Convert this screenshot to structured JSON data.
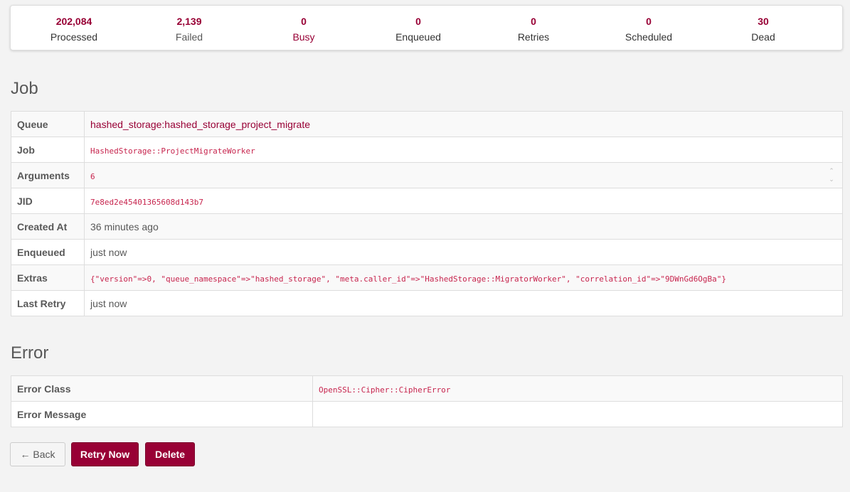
{
  "summary": [
    {
      "value": "202,084",
      "label": "Processed"
    },
    {
      "value": "2,139",
      "label": "Failed"
    },
    {
      "value": "0",
      "label": "Busy"
    },
    {
      "value": "0",
      "label": "Enqueued"
    },
    {
      "value": "0",
      "label": "Retries"
    },
    {
      "value": "0",
      "label": "Scheduled"
    },
    {
      "value": "30",
      "label": "Dead"
    }
  ],
  "job": {
    "heading": "Job",
    "rows": {
      "queue": {
        "label": "Queue",
        "value": "hashed_storage:hashed_storage_project_migrate"
      },
      "job": {
        "label": "Job",
        "value": "HashedStorage::ProjectMigrateWorker"
      },
      "arguments": {
        "label": "Arguments",
        "value": "6"
      },
      "jid": {
        "label": "JID",
        "value": "7e8ed2e45401365608d143b7"
      },
      "created_at": {
        "label": "Created At",
        "value": "36 minutes ago"
      },
      "enqueued": {
        "label": "Enqueued",
        "value": "just now"
      },
      "extras": {
        "label": "Extras",
        "value": "{\"version\"=>0, \"queue_namespace\"=>\"hashed_storage\", \"meta.caller_id\"=>\"HashedStorage::MigratorWorker\", \"correlation_id\"=>\"9DWnGd6OgBa\"}"
      },
      "last_retry": {
        "label": "Last Retry",
        "value": "just now"
      }
    }
  },
  "error": {
    "heading": "Error",
    "rows": {
      "error_class": {
        "label": "Error Class",
        "value": "OpenSSL::Cipher::CipherError"
      },
      "error_message": {
        "label": "Error Message",
        "value": ""
      }
    }
  },
  "actions": {
    "back": "← Back",
    "retry_now": "Retry Now",
    "delete": "Delete"
  },
  "colors": {
    "accent": "#980035",
    "code": "#c7254e",
    "text": "#585858",
    "background": "#f3f3f3"
  }
}
